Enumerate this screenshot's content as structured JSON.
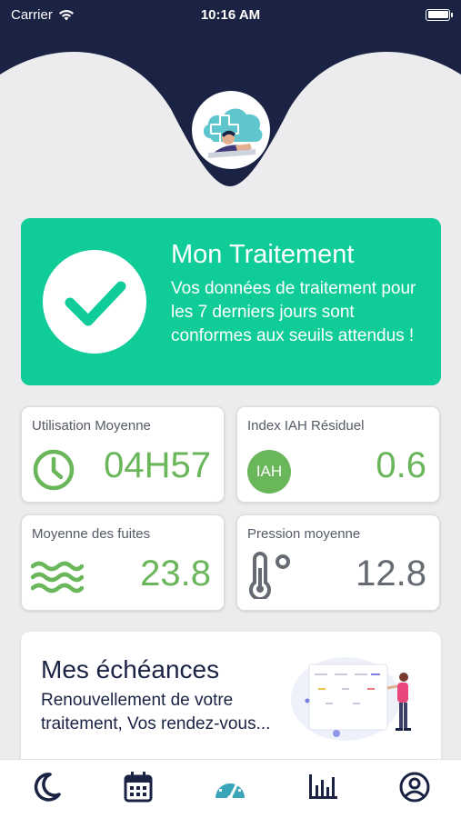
{
  "status_bar": {
    "carrier": "Carrier",
    "time": "10:16 AM"
  },
  "colors": {
    "navy": "#1b2344",
    "accent_green": "#0fcc98",
    "stat_green": "#6ab65a",
    "stat_gray": "#666a72",
    "active_tab": "#3aa5b8"
  },
  "treatment": {
    "title": "Mon Traitement",
    "description": "Vos données de traitement pour les 7 derniers jours sont conformes aux seuils attendus !",
    "icon": "check-icon"
  },
  "stats": [
    {
      "label": "Utilisation Moyenne",
      "value": "04H57",
      "icon": "clock-icon"
    },
    {
      "label": "Index IAH Résiduel",
      "value": "0.6",
      "icon": "iah-badge",
      "badge_text": "IAH"
    },
    {
      "label": "Moyenne des fuites",
      "value": "23.8",
      "icon": "waves-icon"
    },
    {
      "label": "Pression moyenne",
      "value": "12.8",
      "icon": "thermometer-icon"
    }
  ],
  "echeances": {
    "title": "Mes échéances",
    "description": "Renouvellement de votre traitement, Vos rendez-vous..."
  },
  "tabs": [
    {
      "name": "sleep",
      "icon": "moon-icon",
      "active": false
    },
    {
      "name": "calendar",
      "icon": "calendar-icon",
      "active": false
    },
    {
      "name": "dashboard",
      "icon": "speedometer-icon",
      "active": true
    },
    {
      "name": "stats",
      "icon": "bar-chart-icon",
      "active": false
    },
    {
      "name": "profile",
      "icon": "user-icon",
      "active": false
    }
  ]
}
